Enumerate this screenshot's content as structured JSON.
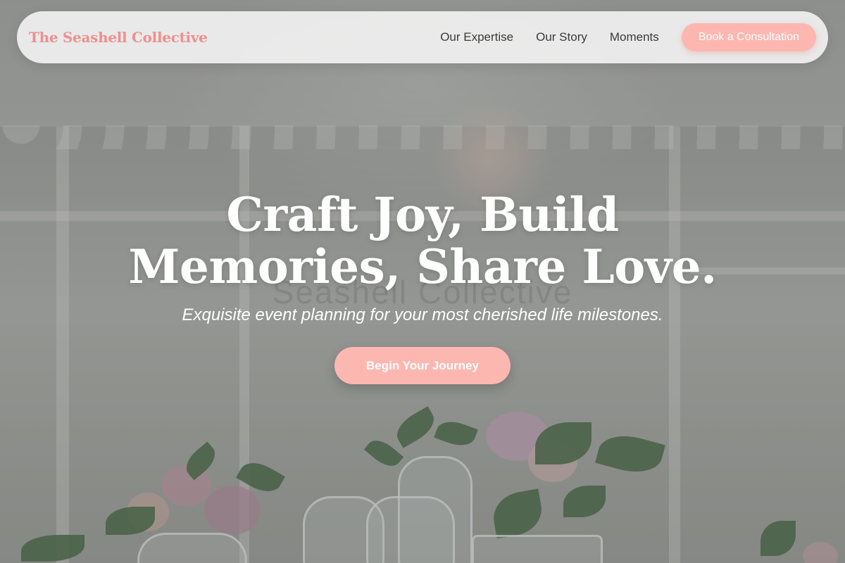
{
  "header": {
    "brand": "The Seashell Collective",
    "nav": [
      {
        "label": "Our Expertise"
      },
      {
        "label": "Our Story"
      },
      {
        "label": "Moments"
      }
    ],
    "cta_label": "Book a Consultation"
  },
  "hero": {
    "title": "Craft Joy, Build Memories, Share Love.",
    "subtitle": "Exquisite event planning for your most cherished life milestones.",
    "cta_label": "Begin Your Journey",
    "background_watermark": "Seashell Collective"
  },
  "colors": {
    "brand_pink": "#ee8f8f",
    "button_pink": "#fdb6b0",
    "navbar_bg": "#f0f0f0",
    "nav_text": "#3a3a3a",
    "hero_text": "#ffffff"
  }
}
